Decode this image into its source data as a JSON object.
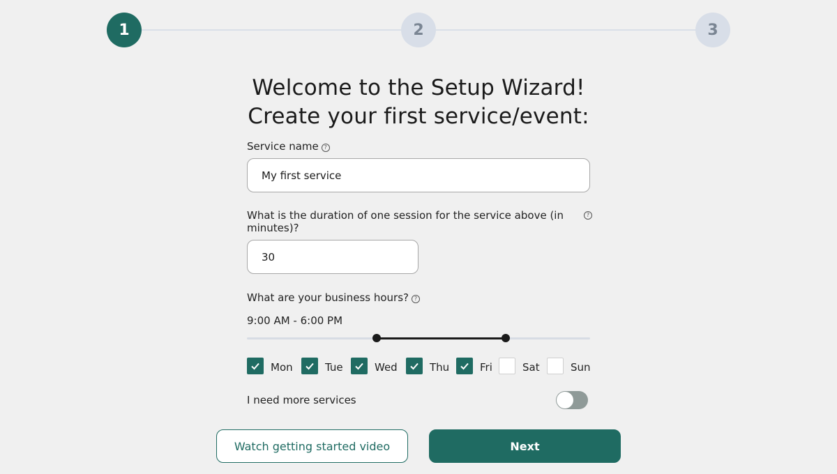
{
  "stepper": {
    "steps": [
      {
        "label": "1",
        "state": "active"
      },
      {
        "label": "2",
        "state": "inactive"
      },
      {
        "label": "3",
        "state": "inactive"
      }
    ]
  },
  "title": {
    "line1": "Welcome to the Setup Wizard!",
    "line2": "Create your first service/event:"
  },
  "form": {
    "service_name": {
      "label": "Service name",
      "value": "My first service",
      "help_icon": "question-circle-icon"
    },
    "duration": {
      "label": "What is the duration of one session for the service above (in minutes)?",
      "value": "30",
      "help_icon": "question-circle-icon"
    },
    "business_hours": {
      "label": "What are your business hours?",
      "value_text": "9:00 AM - 6:00 PM",
      "help_icon": "question-circle-icon",
      "slider": {
        "min_fraction": 0.378,
        "max_fraction": 0.754
      }
    },
    "days": [
      {
        "label": "Mon",
        "checked": true
      },
      {
        "label": "Tue",
        "checked": true
      },
      {
        "label": "Wed",
        "checked": true
      },
      {
        "label": "Thu",
        "checked": true
      },
      {
        "label": "Fri",
        "checked": true
      },
      {
        "label": "Sat",
        "checked": false
      },
      {
        "label": "Sun",
        "checked": false
      }
    ],
    "more_services": {
      "label": "I need more services",
      "enabled": false
    }
  },
  "buttons": {
    "secondary_label": "Watch getting started video",
    "primary_label": "Next"
  },
  "colors": {
    "accent": "#1f6b62",
    "background": "#f0f0f0",
    "inactive_step": "#d8dee8"
  }
}
